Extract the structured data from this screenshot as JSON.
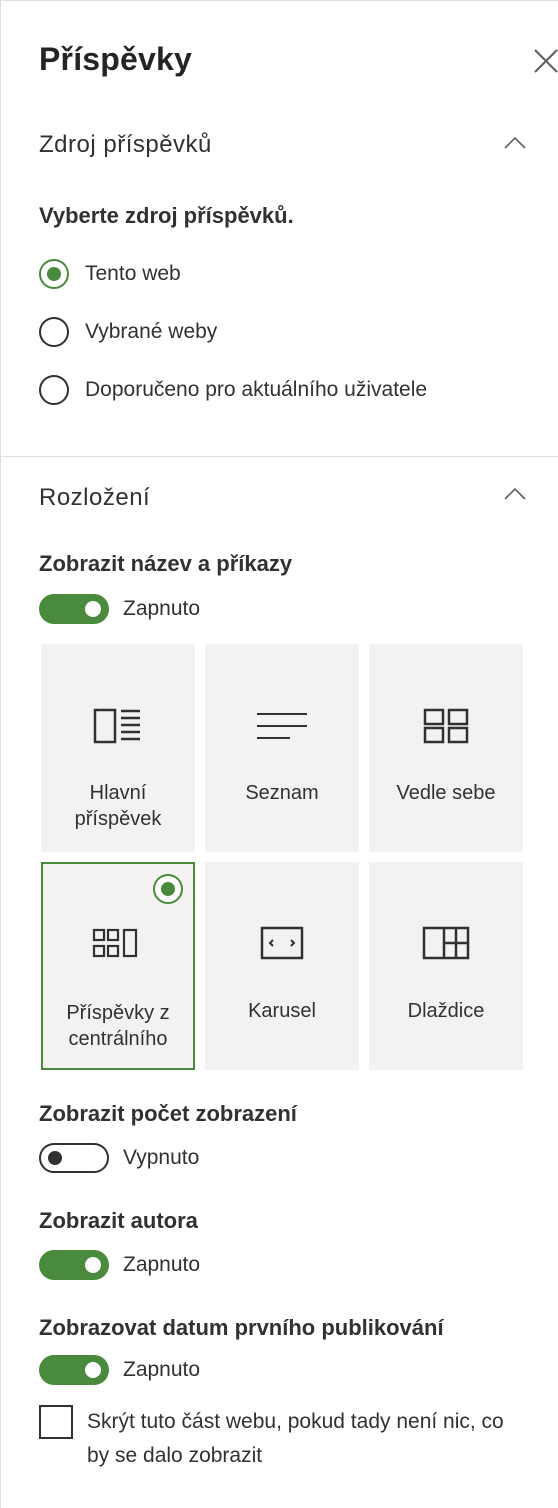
{
  "panel": {
    "title": "Příspěvky",
    "close_icon": "close-icon"
  },
  "source_section": {
    "header": "Zdroj příspěvků",
    "prompt": "Vyberte zdroj příspěvků.",
    "options": [
      {
        "label": "Tento web",
        "checked": true
      },
      {
        "label": "Vybrané weby",
        "checked": false
      },
      {
        "label": "Doporučeno pro aktuálního uživatele",
        "checked": false
      }
    ]
  },
  "layout_section": {
    "header": "Rozložení",
    "show_title": {
      "label": "Zobrazit název a příkazy",
      "state": "Zapnuto",
      "on": true
    },
    "layouts": [
      {
        "label": "Hlavní příspěvek",
        "icon": "hero-layout-icon",
        "selected": false
      },
      {
        "label": "Seznam",
        "icon": "list-layout-icon",
        "selected": false
      },
      {
        "label": "Vedle sebe",
        "icon": "side-by-side-layout-icon",
        "selected": false
      },
      {
        "label": "Příspěvky z centrálního",
        "icon": "hub-news-layout-icon",
        "selected": true
      },
      {
        "label": "Karusel",
        "icon": "carousel-layout-icon",
        "selected": false
      },
      {
        "label": "Dlaždice",
        "icon": "tiles-layout-icon",
        "selected": false
      }
    ],
    "show_views": {
      "label": "Zobrazit počet zobrazení",
      "state": "Vypnuto",
      "on": false
    },
    "show_author": {
      "label": "Zobrazit autora",
      "state": "Zapnuto",
      "on": true
    },
    "show_date": {
      "label": "Zobrazovat datum prvního publikování",
      "state": "Zapnuto",
      "on": true
    },
    "hide_empty": {
      "label": "Skrýt tuto část webu, pokud tady není nic, co by se dalo zobrazit",
      "checked": false
    }
  },
  "colors": {
    "accent": "#4a8a3c",
    "tile_bg": "#f3f2f1",
    "text": "#323130"
  }
}
